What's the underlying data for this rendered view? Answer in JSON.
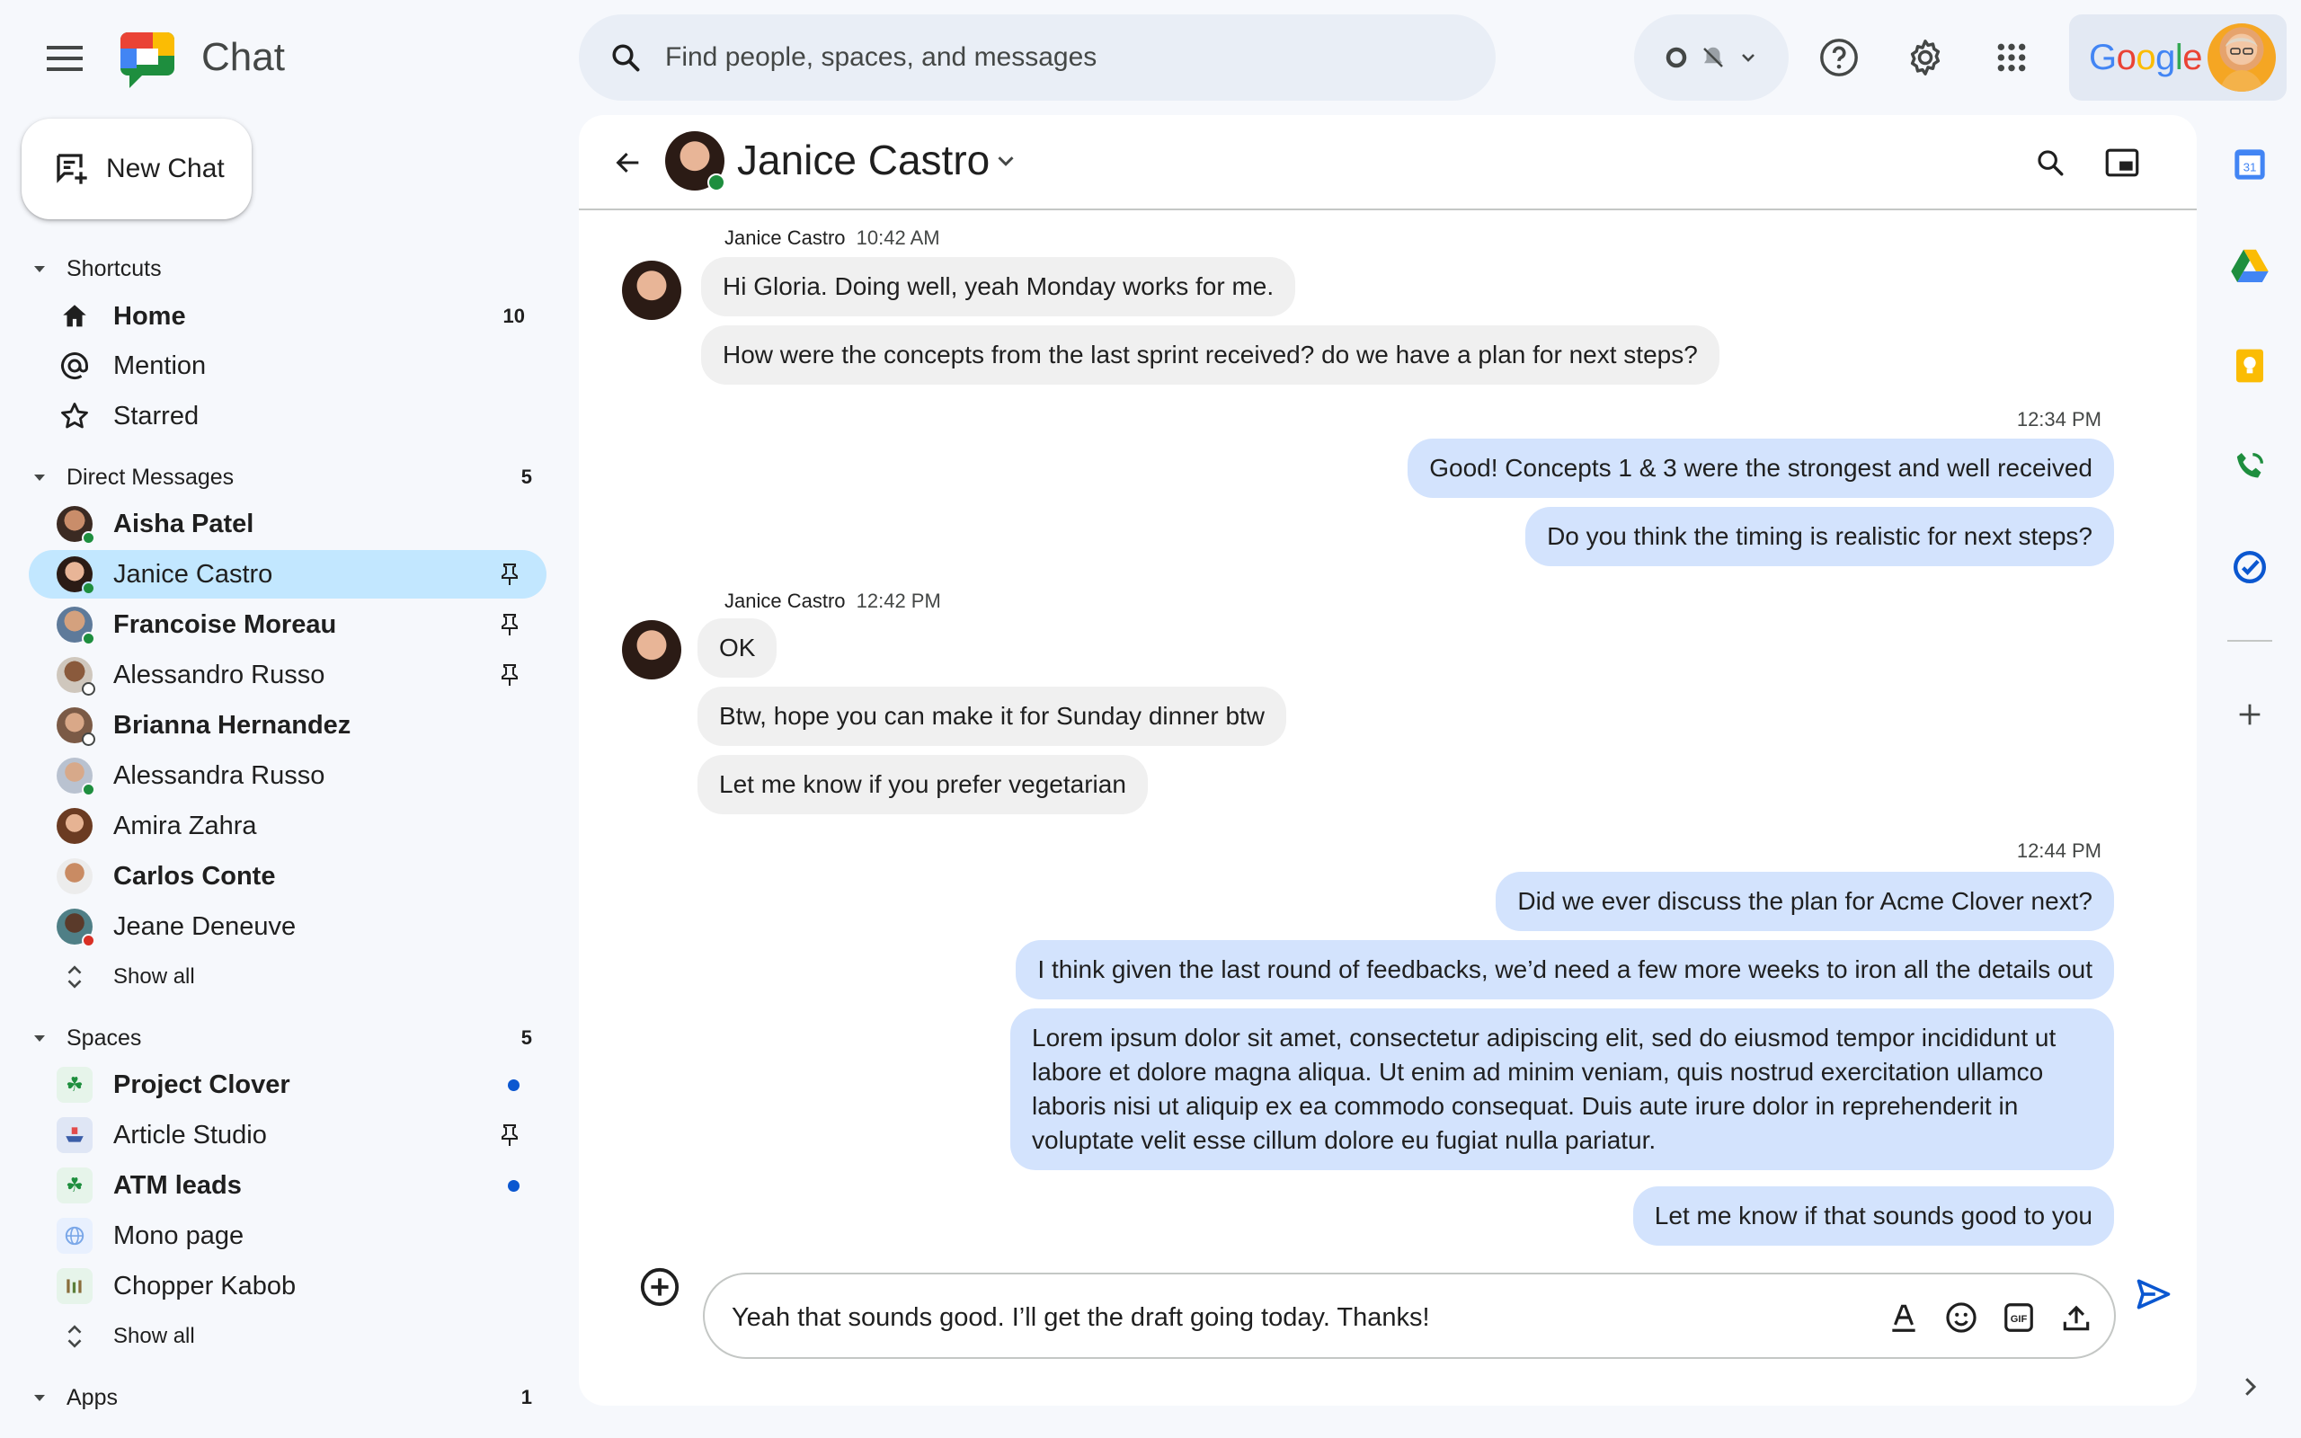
{
  "app": {
    "name": "Chat"
  },
  "search": {
    "placeholder": "Find people, spaces, and messages"
  },
  "account": {
    "brand": "Google"
  },
  "colors": {
    "accent": "#0b57d0",
    "active_bg": "#c2e7ff",
    "outgoing_bubble": "#d3e3fd",
    "incoming_bubble": "#f0f0f0",
    "online": "#1e8e3e",
    "busy": "#d93025"
  },
  "sidebar": {
    "new_chat_label": "New Chat",
    "shortcuts": {
      "title": "Shortcuts",
      "items": [
        {
          "label": "Home",
          "icon": "home-icon",
          "count": "10"
        },
        {
          "label": "Mention",
          "icon": "at-icon"
        },
        {
          "label": "Starred",
          "icon": "star-icon"
        }
      ]
    },
    "direct_messages": {
      "title": "Direct Messages",
      "count": "5",
      "items": [
        {
          "label": "Aisha Patel",
          "bold": true,
          "status": "online"
        },
        {
          "label": "Janice Castro",
          "bold": false,
          "status": "online",
          "pinned": true,
          "active": true
        },
        {
          "label": "Francoise Moreau",
          "bold": true,
          "status": "online",
          "pinned": true
        },
        {
          "label": "Alessandro Russo",
          "bold": false,
          "status": "away",
          "pinned": true
        },
        {
          "label": "Brianna Hernandez",
          "bold": true,
          "status": "away"
        },
        {
          "label": "Alessandra Russo",
          "bold": false,
          "status": "online"
        },
        {
          "label": "Amira Zahra",
          "bold": false
        },
        {
          "label": "Carlos Conte",
          "bold": true
        },
        {
          "label": "Jeane Deneuve",
          "bold": false,
          "status": "busy"
        }
      ],
      "show_all": "Show all"
    },
    "spaces": {
      "title": "Spaces",
      "count": "5",
      "items": [
        {
          "label": "Project Clover",
          "bold": true,
          "unread": true
        },
        {
          "label": "Article Studio",
          "bold": false,
          "pinned": true
        },
        {
          "label": "ATM leads",
          "bold": true,
          "unread": true
        },
        {
          "label": "Mono page",
          "bold": false
        },
        {
          "label": "Chopper Kabob",
          "bold": false
        }
      ],
      "show_all": "Show all"
    },
    "apps": {
      "title": "Apps",
      "count": "1"
    }
  },
  "conversation": {
    "contact": "Janice Castro",
    "groups": [
      {
        "direction": "in",
        "sender": "Janice Castro",
        "time": "10:42 AM",
        "messages": [
          "Hi Gloria. Doing well, yeah Monday works for me.",
          "How were the concepts from the last sprint received? do we have a plan for next steps?"
        ]
      },
      {
        "direction": "out",
        "time": "12:34 PM",
        "messages": [
          "Good! Concepts 1 & 3 were the strongest and well received",
          "Do you think the timing is realistic for next steps?"
        ]
      },
      {
        "direction": "in",
        "sender": "Janice Castro",
        "time": "12:42 PM",
        "messages": [
          "OK",
          "Btw, hope you can make it for Sunday dinner btw",
          "Let me know if you prefer vegetarian"
        ]
      },
      {
        "direction": "out",
        "time": "12:44 PM",
        "messages": [
          "Did we ever discuss the plan for Acme Clover next?",
          "I think given the last round of feedbacks, we’d need a few more weeks to iron all the details out",
          "Lorem ipsum dolor sit amet, consectetur adipiscing elit, sed do eiusmod tempor incididunt ut labore et dolore magna aliqua. Ut enim ad minim veniam, quis nostrud exercitation ullamco laboris nisi ut aliquip ex ea commodo consequat. Duis aute irure dolor in reprehenderit in voluptate velit esse cillum dolore eu fugiat nulla pariatur.",
          "Let me know if that sounds good to you"
        ]
      }
    ],
    "composer_value": "Yeah that sounds good. I’ll get the draft going today. Thanks!"
  },
  "right_rail": {
    "calendar_day": "31",
    "items": [
      "calendar-icon",
      "drive-icon",
      "keep-icon",
      "voice-icon",
      "tasks-icon",
      "add-icon"
    ]
  }
}
